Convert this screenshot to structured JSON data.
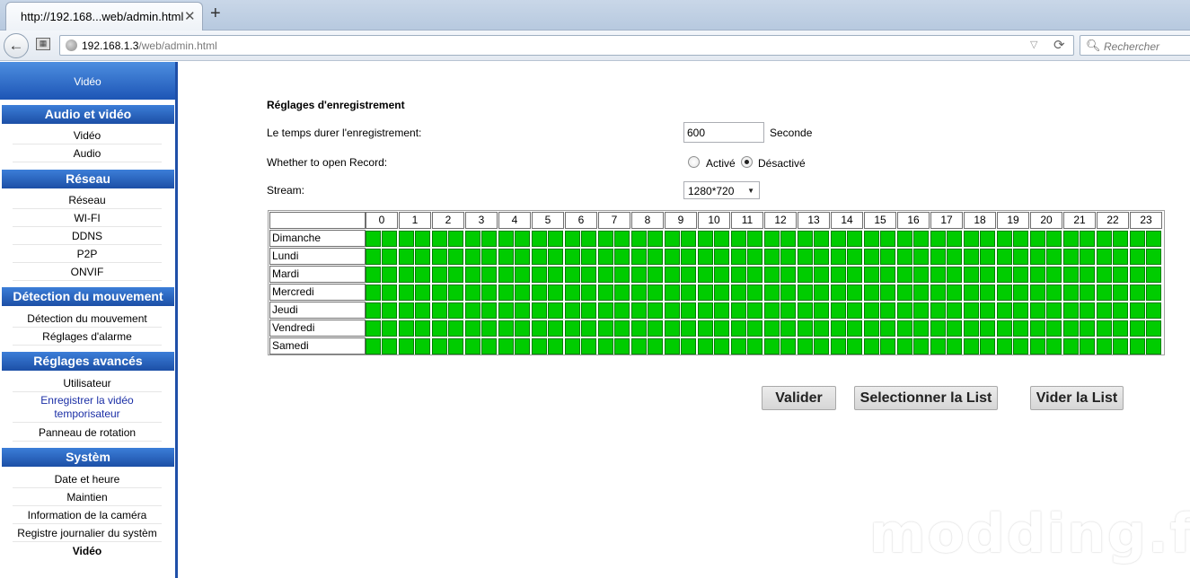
{
  "browser": {
    "tab_title": "http://192.168...web/admin.html",
    "tab_close": "✕",
    "new_tab": "+",
    "back_glyph": "←",
    "url_host": "192.168.1.3",
    "url_path": "/web/admin.html",
    "search_placeholder": "Rechercher",
    "icons": [
      "back-arrow-icon",
      "history-icon",
      "globe-icon",
      "dropdown-icon",
      "reload-icon",
      "search-icon"
    ]
  },
  "sidebar": {
    "top_label": "Vidéo",
    "sections": [
      {
        "title": "Audio et vidéo",
        "items": [
          "Vidéo",
          "Audio"
        ]
      },
      {
        "title": "Réseau",
        "items": [
          "Réseau",
          "WI-FI",
          "DDNS",
          "P2P",
          "ONVIF"
        ]
      },
      {
        "title": "Détection du mouvement",
        "items": [
          "Détection du mouvement",
          "Réglages d'alarme"
        ]
      },
      {
        "title": "Réglages avancés",
        "items": [
          "Utilisateur",
          "Enregistrer la vidéo temporisateur",
          "Panneau de rotation"
        ]
      },
      {
        "title": "Systèm",
        "items": [
          "Date et heure",
          "Maintien",
          "Information de la caméra",
          "Registre journalier du systèm",
          "Vidéo"
        ]
      }
    ],
    "active_item": "Enregistrer la vidéo temporisateur"
  },
  "main": {
    "title": "Réglages d'enregistrement",
    "duration_label": "Le temps durer l'enregistrement:",
    "duration_value": "600",
    "duration_unit": "Seconde",
    "record_label": "Whether to open Record:",
    "record_options": [
      "Activé",
      "Désactivé"
    ],
    "record_selected": "Désactivé",
    "stream_label": "Stream:",
    "stream_value": "1280*720"
  },
  "schedule": {
    "hours": [
      "0",
      "1",
      "2",
      "3",
      "4",
      "5",
      "6",
      "7",
      "8",
      "9",
      "10",
      "11",
      "12",
      "13",
      "14",
      "15",
      "16",
      "17",
      "18",
      "19",
      "20",
      "21",
      "22",
      "23"
    ],
    "days": [
      "Dimanche",
      "Lundi",
      "Mardi",
      "Mercredi",
      "Jeudi",
      "Vendredi",
      "Samedi"
    ],
    "slot_color": "#00cc00",
    "all_slots_enabled": true
  },
  "buttons": {
    "validate": "Valider",
    "select_list": "Selectionner la List",
    "clear_list": "Vider la List"
  },
  "watermark": "modding.fr"
}
